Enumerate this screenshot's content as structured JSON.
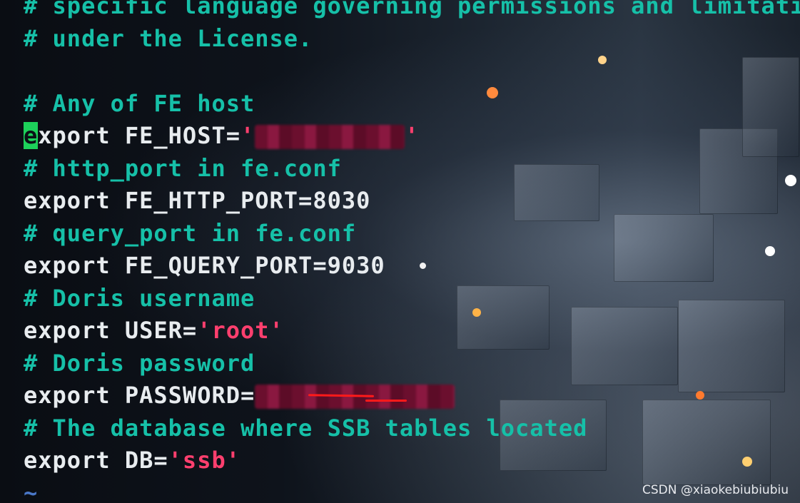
{
  "lines": [
    {
      "type": "comment",
      "text": "# specific language governing permissions and limitations"
    },
    {
      "type": "comment",
      "text": "# under the License."
    },
    {
      "type": "blank",
      "text": ""
    },
    {
      "type": "comment",
      "text": "# Any of FE host"
    },
    {
      "type": "host",
      "cursor_char": "e",
      "prefix": "xport FE_HOST=",
      "quote_open": "'",
      "quote_close": "'"
    },
    {
      "type": "comment",
      "text": "# http_port in fe.conf"
    },
    {
      "type": "plain",
      "text": "export FE_HTTP_PORT=8030"
    },
    {
      "type": "comment",
      "text": "# query_port in fe.conf"
    },
    {
      "type": "plain",
      "text": "export FE_QUERY_PORT=9030"
    },
    {
      "type": "comment",
      "text": "# Doris username"
    },
    {
      "type": "string",
      "prefix": "export USER=",
      "value": "'root'"
    },
    {
      "type": "comment",
      "text": "# Doris password"
    },
    {
      "type": "password",
      "prefix": "export PASSWORD="
    },
    {
      "type": "comment",
      "text": "# The database where SSB tables located"
    },
    {
      "type": "string",
      "prefix": "export DB=",
      "value": "'ssb'"
    },
    {
      "type": "tilde",
      "text": "~"
    }
  ],
  "watermark": "CSDN @xiaokebiubiubiu",
  "colors": {
    "comment": "#16c0a8",
    "plain": "#e8ecef",
    "string": "#ff3f6e",
    "cursor": "#1dd15a",
    "tilde": "#4a78c8",
    "redaction": "#7a1236"
  }
}
